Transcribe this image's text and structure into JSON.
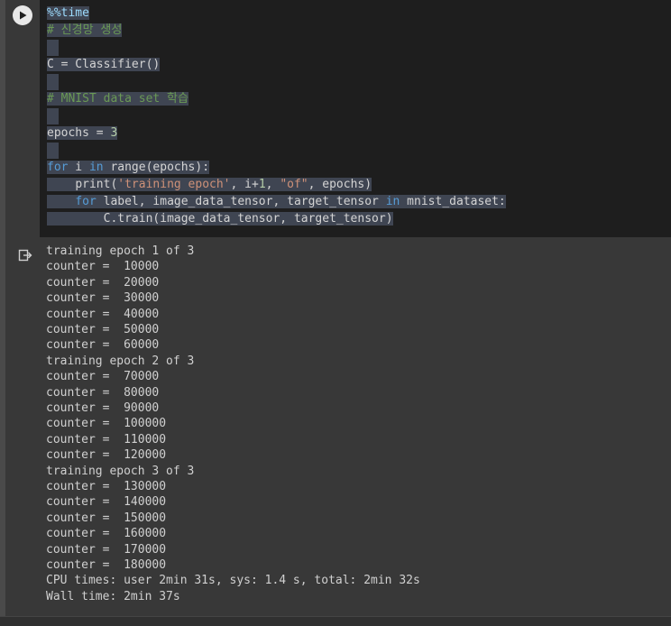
{
  "code": {
    "magic": "%%time",
    "comment1": "# 신경망 생성",
    "line_classifier": "C = Classifier()",
    "comment2": "# MNIST data set 학습",
    "epochs_prefix": "epochs = ",
    "epochs_value": "3",
    "for_kw": "for",
    "for_var": " i ",
    "in_kw": "in",
    "for_rest": " range(epochs):",
    "print_indent": "    ",
    "print_open": "print(",
    "print_str1": "'training epoch'",
    "print_mid": ", i+",
    "print_one": "1",
    "print_comma": ", ",
    "print_str2": "\"of\"",
    "print_close": ", epochs)",
    "inner_indent": "    ",
    "inner_for_kw": "for",
    "inner_vars": " label, image_data_tensor, target_tensor ",
    "inner_in_kw": "in",
    "inner_rest": " mnist_dataset:",
    "train_indent": "        ",
    "train_call": "C.train(image_data_tensor, target_tensor)"
  },
  "output_lines": [
    "training epoch 1 of 3",
    "counter =  10000",
    "counter =  20000",
    "counter =  30000",
    "counter =  40000",
    "counter =  50000",
    "counter =  60000",
    "training epoch 2 of 3",
    "counter =  70000",
    "counter =  80000",
    "counter =  90000",
    "counter =  100000",
    "counter =  110000",
    "counter =  120000",
    "training epoch 3 of 3",
    "counter =  130000",
    "counter =  140000",
    "counter =  150000",
    "counter =  160000",
    "counter =  170000",
    "counter =  180000",
    "CPU times: user 2min 31s, sys: 1.4 s, total: 2min 32s",
    "Wall time: 2min 37s"
  ],
  "icons": {
    "run": "play-icon",
    "output": "output-redirect-icon"
  },
  "colors": {
    "keyword": "#569cd6",
    "comment": "#6a9955",
    "string": "#ce9178",
    "number": "#b5cea8",
    "selection": "#3f4552"
  }
}
